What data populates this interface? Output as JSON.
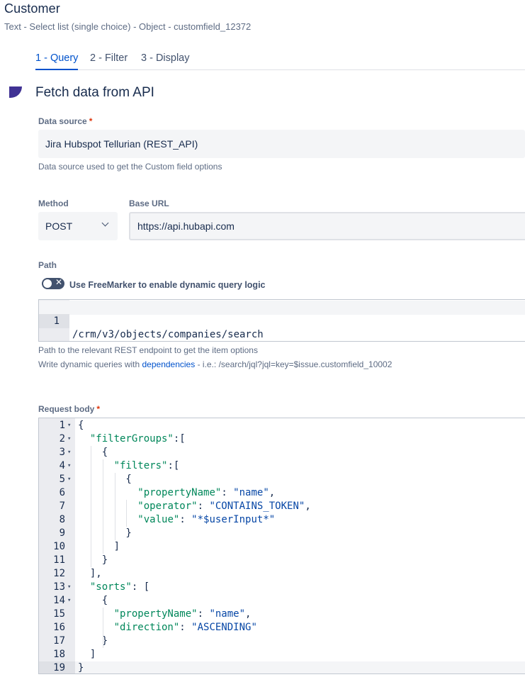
{
  "header": {
    "title": "Customer",
    "subtitle": "Text - Select list (single choice) - Object - customfield_12372"
  },
  "tabs": [
    {
      "label": "1 - Query",
      "active": true
    },
    {
      "label": "2 - Filter",
      "active": false
    },
    {
      "label": "3 - Display",
      "active": false
    }
  ],
  "section": {
    "title": "Fetch data from API"
  },
  "data_source": {
    "label": "Data source",
    "required_mark": "*",
    "value": "Jira Hubspot Tellurian (REST_API)",
    "help": "Data source used to get the Custom field options"
  },
  "method": {
    "label": "Method",
    "value": "POST"
  },
  "base_url": {
    "label": "Base URL",
    "value": "https://api.hubapi.com"
  },
  "path": {
    "label": "Path",
    "toggle_label": "Use FreeMarker to enable dynamic query logic",
    "toggle_on": false,
    "line_number": "1",
    "value": "/crm/v3/objects/companies/search",
    "help1": "Path to the relevant REST endpoint to get the item options",
    "help2_prefix": "Write dynamic queries with ",
    "help2_link": "dependencies",
    "help2_suffix": " - i.e.: /search/jql?jql=key=$issue.customfield_10002"
  },
  "request_body": {
    "label": "Request body",
    "required_mark": "*",
    "lines": [
      "{",
      "  \"filterGroups\":[",
      "    {",
      "      \"filters\":[",
      "        {",
      "          \"propertyName\": \"name\",",
      "          \"operator\": \"CONTAINS_TOKEN\",",
      "          \"value\": \"*$userInput*\"",
      "        }",
      "      ]",
      "    }",
      "  ],",
      "  \"sorts\": [",
      "    {",
      "      \"propertyName\": \"name\",",
      "      \"direction\": \"ASCENDING\"",
      "    }",
      "  ]",
      "}"
    ],
    "foldable_lines": [
      1,
      2,
      3,
      4,
      5,
      13,
      14
    ],
    "active_line": 19
  },
  "colors": {
    "accent": "#0052cc",
    "section_marker": "#403294",
    "required": "#de350b",
    "json_key": "#00875a",
    "json_string": "#0747a6"
  },
  "icons": {
    "method_dropdown": "chevron-down-icon",
    "toggle_off": "close-icon",
    "fold": "fold-arrow-icon"
  }
}
